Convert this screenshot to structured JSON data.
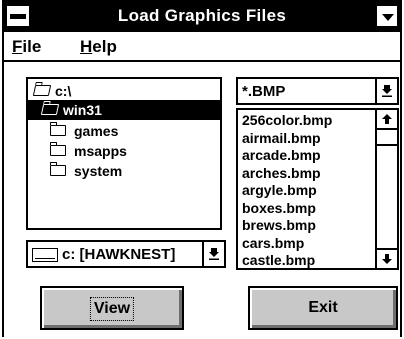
{
  "window": {
    "title": "Load Graphics Files",
    "menus": [
      {
        "label": "File",
        "accel": "F",
        "rest": "ile"
      },
      {
        "label": "Help",
        "accel": "H",
        "rest": "elp"
      }
    ]
  },
  "directory_tree": {
    "items": [
      {
        "label": "c:\\",
        "icon": "open-folder-icon",
        "selected": false
      },
      {
        "label": "win31",
        "icon": "open-folder-icon",
        "selected": true
      },
      {
        "label": "games",
        "icon": "folder-icon",
        "selected": false
      },
      {
        "label": "msapps",
        "icon": "folder-icon",
        "selected": false
      },
      {
        "label": "system",
        "icon": "folder-icon",
        "selected": false
      }
    ]
  },
  "drive": {
    "value": "c: [HAWKNEST]",
    "icon": "drive-icon"
  },
  "filter": {
    "value": "*.BMP"
  },
  "files": {
    "items": [
      "256color.bmp",
      "airmail.bmp",
      "arcade.bmp",
      "arches.bmp",
      "argyle.bmp",
      "boxes.bmp",
      "brews.bmp",
      "cars.bmp",
      "castle.bmp"
    ]
  },
  "buttons": {
    "view": "View",
    "exit": "Exit"
  },
  "colors": {
    "title_bar": "#000000",
    "button_face": "#c8c8c8"
  }
}
